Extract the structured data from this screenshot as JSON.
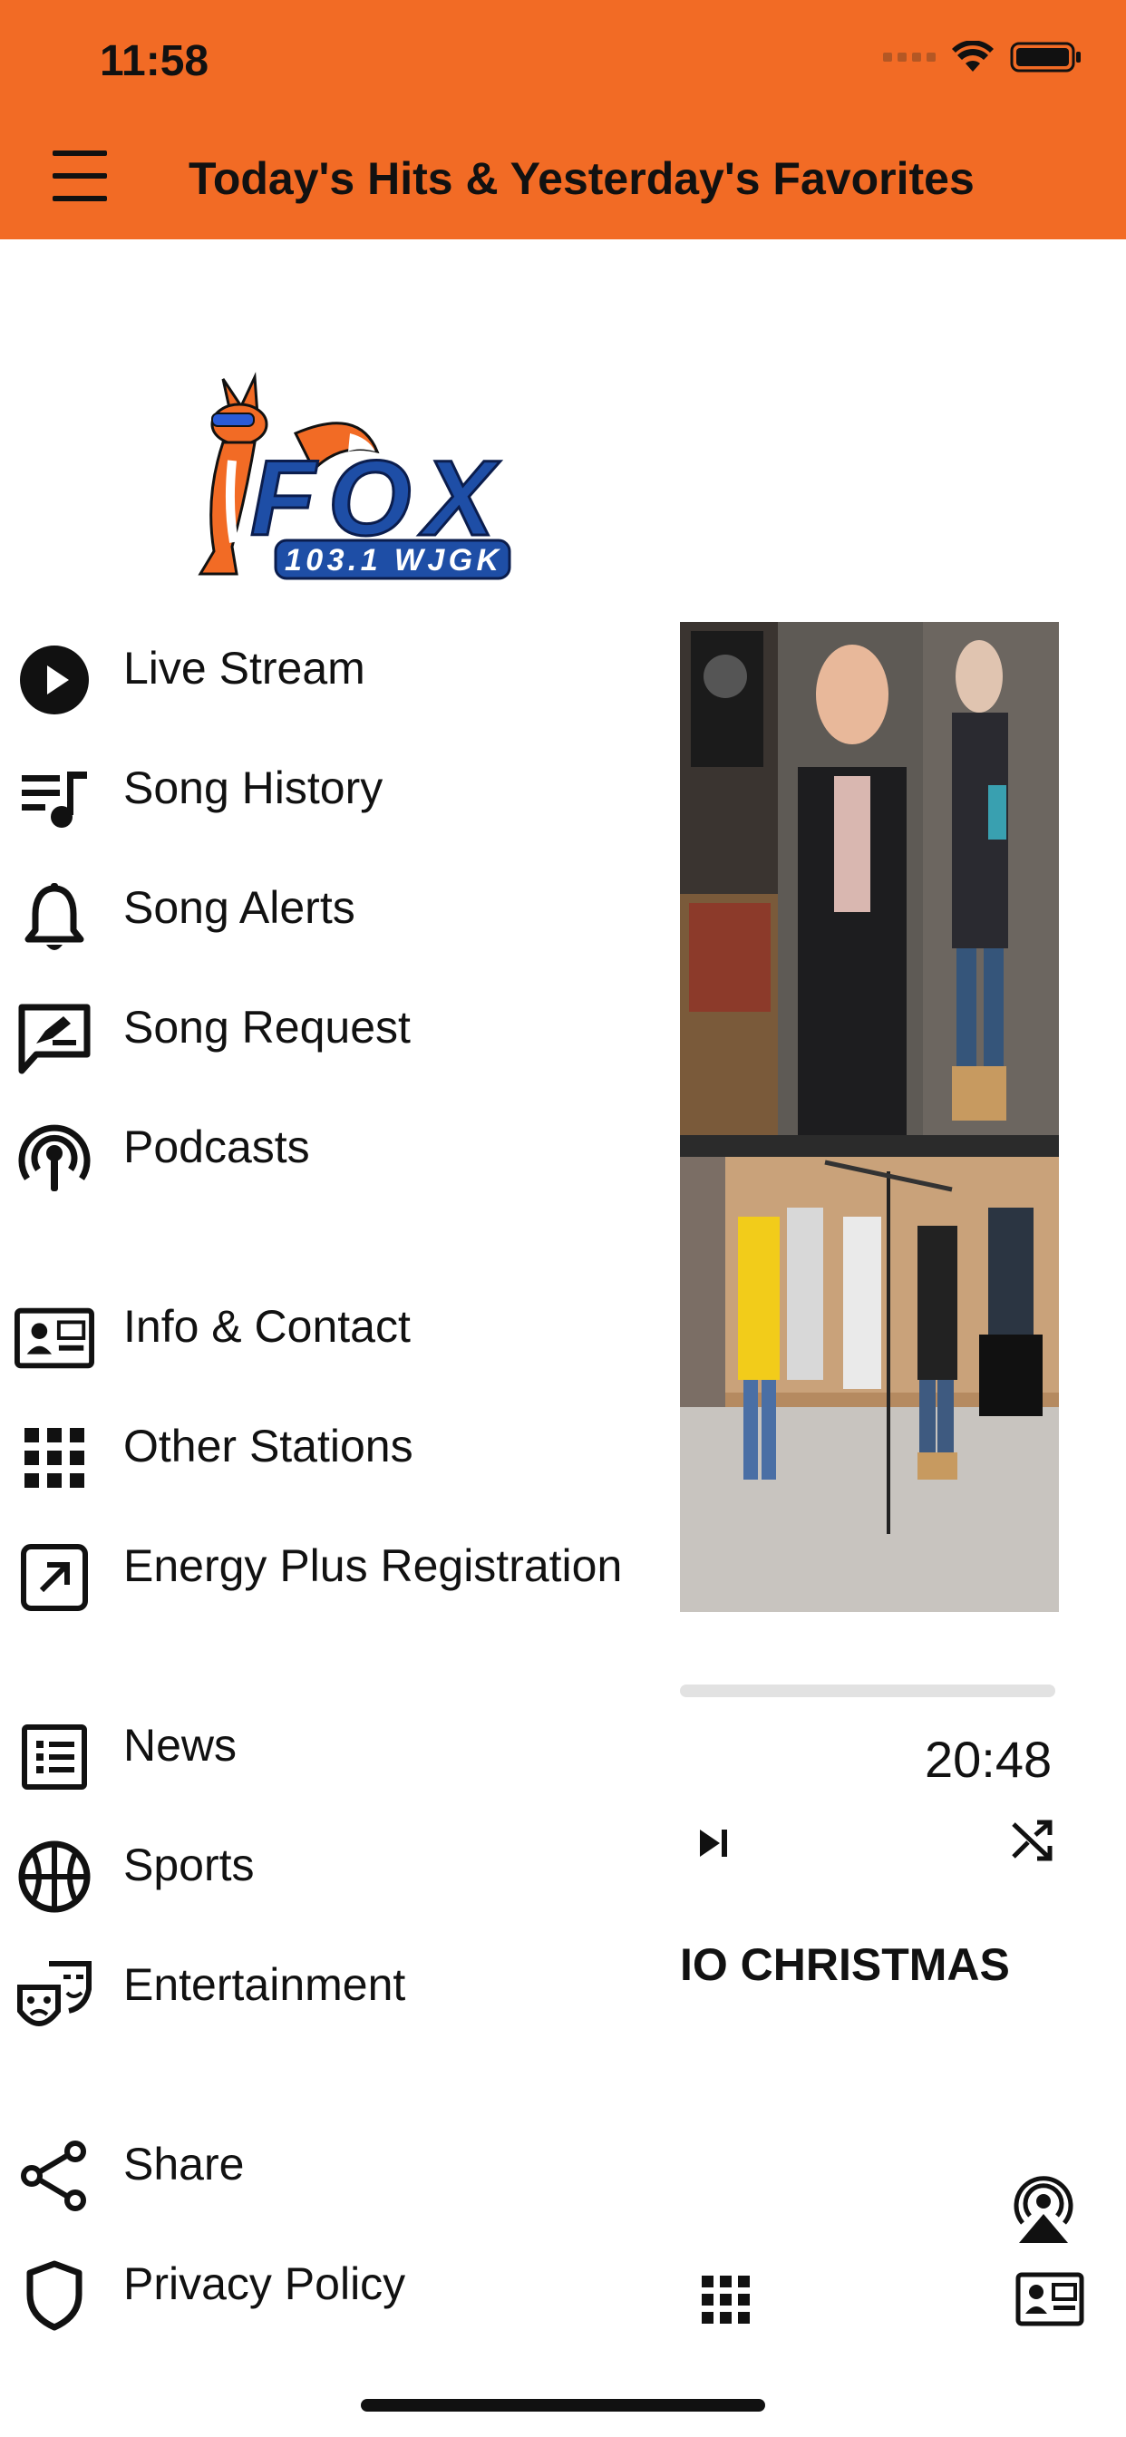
{
  "status_bar": {
    "time": "11:58"
  },
  "header": {
    "title": "Today's Hits & Yesterday's Favorites",
    "menu_icon": "hamburger-icon",
    "color": "#F26B25"
  },
  "logo": {
    "main": "FOX",
    "sub": "103.1 WJGK"
  },
  "menu": {
    "items": [
      {
        "label": "Live Stream",
        "icon": "play-circle-icon"
      },
      {
        "label": "Song History",
        "icon": "playlist-icon"
      },
      {
        "label": "Song Alerts",
        "icon": "bell-icon"
      },
      {
        "label": "Song Request",
        "icon": "request-icon"
      },
      {
        "label": "Podcasts",
        "icon": "podcast-icon"
      },
      {
        "label": "Info & Contact",
        "icon": "contact-card-icon"
      },
      {
        "label": "Other Stations",
        "icon": "grid-icon"
      },
      {
        "label": "Energy Plus Registration",
        "icon": "external-link-icon"
      },
      {
        "label": "News",
        "icon": "news-list-icon"
      },
      {
        "label": "Sports",
        "icon": "basketball-icon"
      },
      {
        "label": "Entertainment",
        "icon": "theater-masks-icon"
      },
      {
        "label": "Share",
        "icon": "share-icon"
      },
      {
        "label": "Privacy Policy",
        "icon": "shield-icon"
      }
    ]
  },
  "player": {
    "time": "20:48",
    "song_title": "IO CHRISTMAS",
    "progress": 0.0
  }
}
